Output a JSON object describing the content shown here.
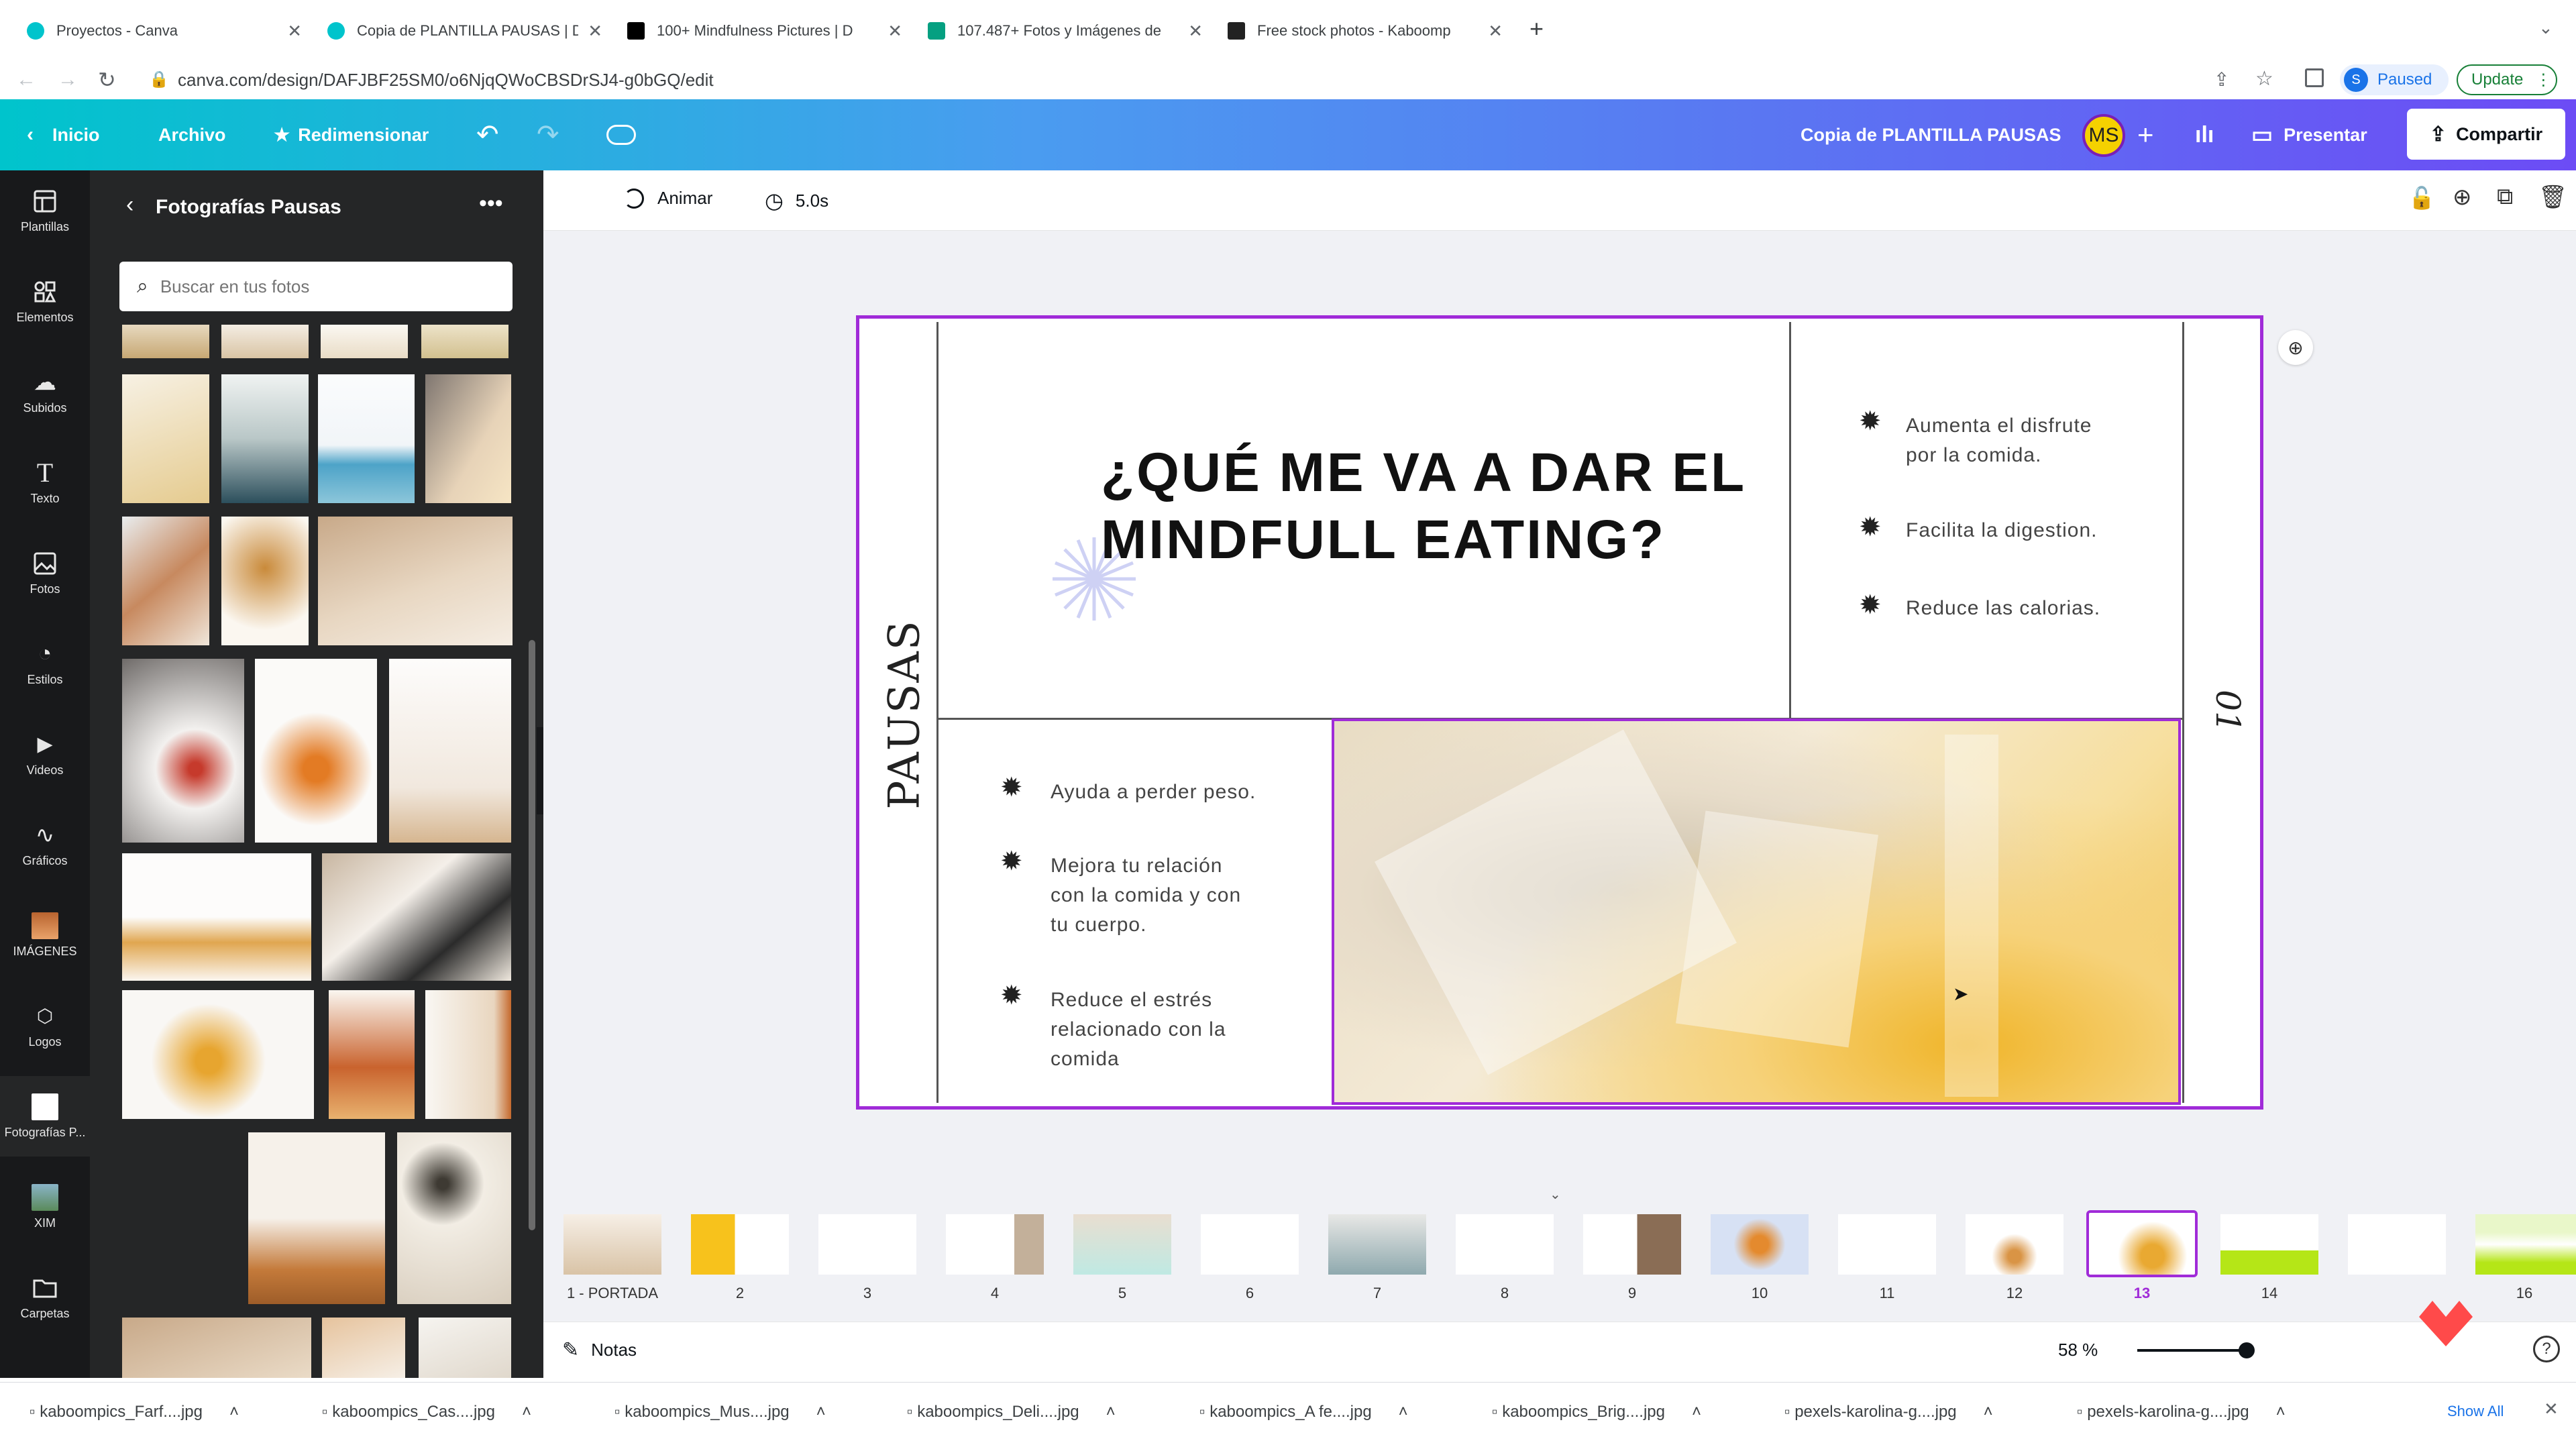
{
  "browser": {
    "tabs": [
      {
        "title": "Proyectos - Canva",
        "icon": "canva-icon",
        "color": "#00c4cc"
      },
      {
        "title": "Copia de PLANTILLA PAUSAS | D",
        "icon": "canva-icon",
        "color": "#00c4cc"
      },
      {
        "title": "100+ Mindfulness Pictures | D",
        "icon": "unsplash-icon",
        "color": "#000000"
      },
      {
        "title": "107.487+ Fotos y Imágenes de",
        "icon": "pexels-icon",
        "color": "#05a081"
      },
      {
        "title": "Free stock photos - Kaboomp",
        "icon": "kaboompics-icon",
        "color": "#222222"
      }
    ],
    "url": "canva.com/design/DAFJBF25SM0/o6NjqQWoCBSDrSJ4-g0bGQ/edit",
    "profile_status": "Paused",
    "profile_initial": "S",
    "update_label": "Update"
  },
  "canva_header": {
    "home": "Inicio",
    "file": "Archivo",
    "resize": "Redimensionar",
    "doc_title": "Copia de PLANTILLA PAUSAS",
    "avatar": "MS",
    "present": "Presentar",
    "share": "Compartir"
  },
  "rail": [
    {
      "label": "Plantillas",
      "icon": "templates-icon"
    },
    {
      "label": "Elementos",
      "icon": "elements-icon"
    },
    {
      "label": "Subidos",
      "icon": "upload-icon"
    },
    {
      "label": "Texto",
      "icon": "text-icon"
    },
    {
      "label": "Fotos",
      "icon": "photos-icon"
    },
    {
      "label": "Estilos",
      "icon": "styles-icon"
    },
    {
      "label": "Videos",
      "icon": "videos-icon"
    },
    {
      "label": "Gráficos",
      "icon": "charts-icon"
    },
    {
      "label": "IMÁGENES",
      "icon": "folder-image-icon"
    },
    {
      "label": "Logos",
      "icon": "logos-icon"
    },
    {
      "label": "Fotografías P...",
      "icon": "folder-white-icon"
    },
    {
      "label": "XIM",
      "icon": "folder-image-icon"
    },
    {
      "label": "Carpetas",
      "icon": "folders-icon"
    }
  ],
  "panel": {
    "title": "Fotografías Pausas",
    "search_placeholder": "Buscar en tus fotos"
  },
  "editor_toolbar": {
    "animate": "Animar",
    "duration": "5.0s"
  },
  "slide": {
    "title_line1": "¿QUÉ ME VA A DAR EL",
    "title_line2": "MINDFULL EATING?",
    "vertical_brand": "PAUSAS",
    "page_number": "01",
    "right_bullets": [
      [
        "Aumenta el disfrute",
        "por la comida."
      ],
      [
        "Facilita la digestion."
      ],
      [
        "Reduce las calorias."
      ]
    ],
    "left_bullets": [
      [
        "Ayuda a perder peso."
      ],
      [
        "Mejora tu relación",
        "con la comida y con",
        "tu cuerpo."
      ],
      [
        "Reduce el estrés",
        "relacionado con la",
        "comida"
      ]
    ]
  },
  "pages": {
    "labels": [
      "1 - PORTADA",
      "2",
      "3",
      "4",
      "5",
      "6",
      "7",
      "8",
      "9",
      "10",
      "11",
      "12",
      "13",
      "14",
      "",
      "16"
    ],
    "active_index": 12
  },
  "notes": {
    "label": "Notas",
    "zoom": "58 %",
    "zoom_level": 0.58
  },
  "downloads": {
    "files": [
      "kaboompics_Farf....jpg",
      "kaboompics_Cas....jpg",
      "kaboompics_Mus....jpg",
      "kaboompics_Deli....jpg",
      "kaboompics_A fe....jpg",
      "kaboompics_Brig....jpg",
      "pexels-karolina-g....jpg",
      "pexels-karolina-g....jpg"
    ],
    "show_all": "Show All"
  }
}
